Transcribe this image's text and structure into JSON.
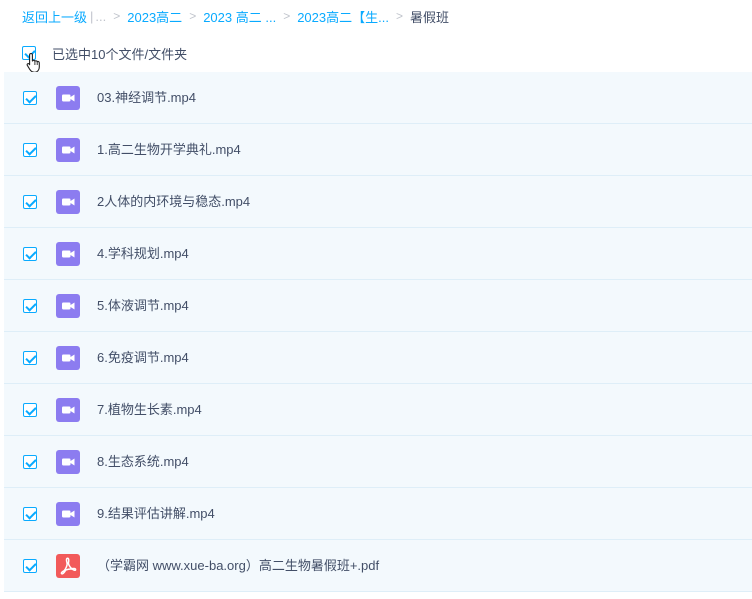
{
  "breadcrumb": {
    "back": "返回上一级",
    "bar": "|",
    "ellipsis": "...",
    "crumbs": [
      "2023高二",
      "2023 高二 ...",
      "2023高二【生..."
    ],
    "current": "暑假班",
    "separator": ">"
  },
  "selection": {
    "label": "已选中10个文件/文件夹"
  },
  "files": [
    {
      "name": "03.神经调节.mp4",
      "type": "video"
    },
    {
      "name": "1.高二生物开学典礼.mp4",
      "type": "video"
    },
    {
      "name": "2人体的内环境与稳态.mp4",
      "type": "video"
    },
    {
      "name": "4.学科规划.mp4",
      "type": "video"
    },
    {
      "name": "5.体液调节.mp4",
      "type": "video"
    },
    {
      "name": "6.免疫调节.mp4",
      "type": "video"
    },
    {
      "name": "7.植物生长素.mp4",
      "type": "video"
    },
    {
      "name": "8.生态系统.mp4",
      "type": "video"
    },
    {
      "name": "9.结果评估讲解.mp4",
      "type": "video"
    },
    {
      "name": "（学霸网 www.xue-ba.org）高二生物暑假班+.pdf",
      "type": "pdf"
    }
  ],
  "colors": {
    "accent": "#09aaff",
    "video_icon": "#8c7cf0",
    "pdf_icon": "#f25a5a",
    "row_bg": "#f3f9fd",
    "text": "#424e67"
  },
  "icons": {
    "video": "video-file-icon",
    "pdf": "pdf-file-icon",
    "check": "checkbox-checked-icon",
    "cursor": "hand-pointer-icon"
  }
}
